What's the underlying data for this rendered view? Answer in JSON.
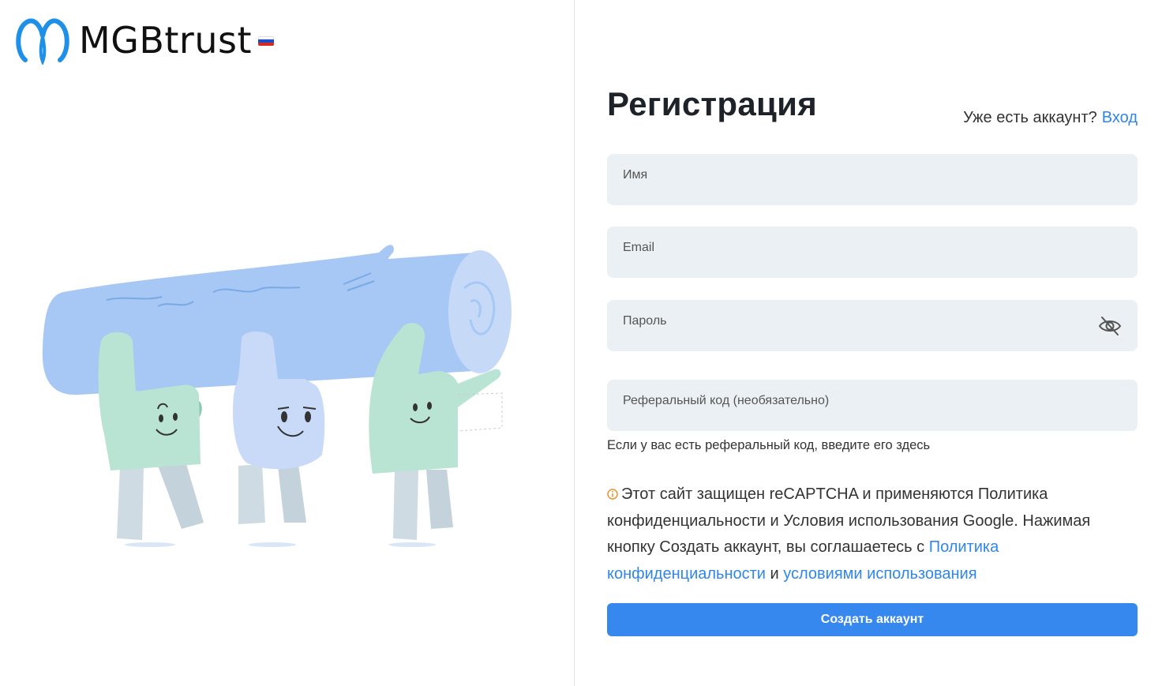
{
  "logo": {
    "brand_name": "MGBtrust",
    "flag": "russia-flag-icon"
  },
  "illustration": {
    "description_icon": "three-characters-carrying-log-illustration"
  },
  "form": {
    "title": "Регистрация",
    "login_prompt": "Уже есть аккаунт?",
    "login_link": "Вход",
    "name_placeholder": "Имя",
    "email_placeholder": "Email",
    "password_placeholder": "Пароль",
    "referral_placeholder": "Реферальный код (необязательно)",
    "referral_hint": "Если у вас есть реферальный код, введите его здесь",
    "password_toggle_icon": "eye-off-icon",
    "submit_label": "Создать аккаунт"
  },
  "notice": {
    "icon": "info-circle-icon",
    "text_part1": "Этот сайт защищен reCAPTCHA и применяются Политика конфиденциальности и Условия использования Google. Нажимая кнопку Создать аккаунт, вы соглашаетесь с ",
    "privacy_link": "Политика конфиденциальности",
    "and": " и ",
    "terms_link": "условиями использования"
  },
  "colors": {
    "accent": "#3688ee",
    "link": "#2f86eb",
    "field_bg": "#eaf0f3",
    "warning": "#f08a24"
  }
}
